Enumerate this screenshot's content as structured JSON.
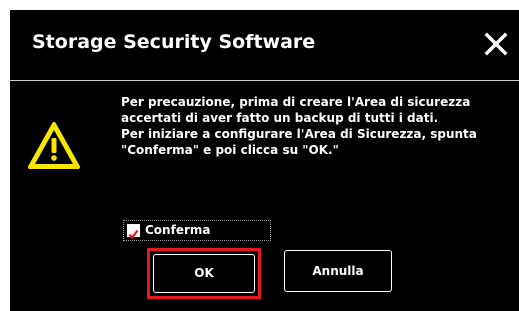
{
  "dialog": {
    "title": "Storage Security Software",
    "close_icon": "close-icon",
    "warning_icon": "warning-icon",
    "message_lines": [
      "Per precauzione, prima di creare l'Area di sicurezza",
      "accertati di aver fatto un backup di tutti i dati.",
      "Per iniziare a configurare l'Area di Sicurezza, spunta",
      "\"Conferma\" e poi clicca su \"OK.\""
    ],
    "confirm_checkbox": {
      "label": "Conferma",
      "checked": true
    },
    "ok_label": "OK",
    "cancel_label": "Annulla"
  },
  "colors": {
    "background": "#000000",
    "text": "#ffffff",
    "highlight": "#e8161d",
    "warning_yellow": "#f7e600"
  }
}
